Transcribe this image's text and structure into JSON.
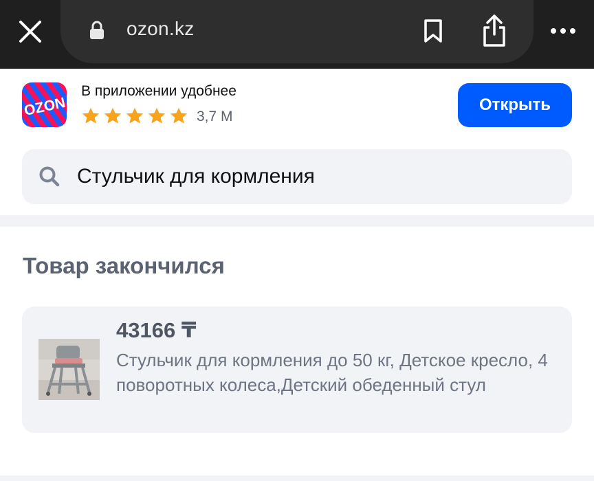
{
  "browser": {
    "url": "ozon.kz",
    "icons": {
      "close": "close-icon",
      "lock": "lock-icon",
      "bookmark": "bookmark-icon",
      "share": "share-icon",
      "more": "more-icon"
    }
  },
  "banner": {
    "logo_text": "OZON",
    "title": "В приложении удобнее",
    "stars": 5,
    "rating_count": "3,7 M",
    "open_label": "Открыть"
  },
  "search": {
    "value": "Стульчик для кормления",
    "icon": "search-icon"
  },
  "section": {
    "title": "Товар закончился"
  },
  "product": {
    "price": "43166 ₸",
    "title": "Стульчик для кормления до 50 кг, Детское кресло, 4 поворотных колеса,Детский обеденный стул"
  },
  "colors": {
    "accent": "#005bff",
    "star": "#f9a21b",
    "logo_blue": "#1b5cff",
    "logo_pink": "#f91155"
  }
}
